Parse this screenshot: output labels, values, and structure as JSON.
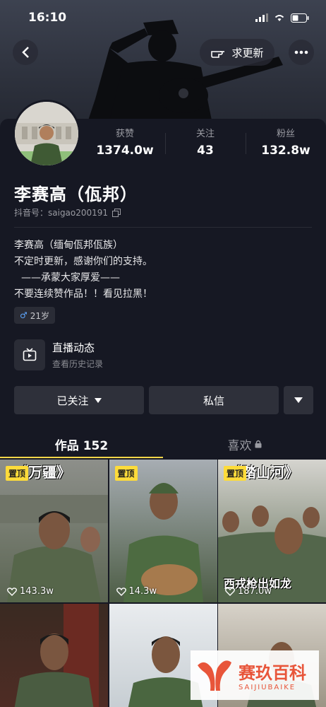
{
  "status": {
    "time": "16:10"
  },
  "header": {
    "update_label": "求更新"
  },
  "profile": {
    "name": "李赛高（佤邦）",
    "douyin_id": "抖音号：saigao200191",
    "bio_lines": [
      "李赛高（缅甸佤邦佤族）",
      "不定时更新，感谢你们的支持。",
      "——承蒙大家厚爱——",
      "不要连续赞作品！！看见拉黑！"
    ],
    "age": "21岁"
  },
  "stats": [
    {
      "label": "获赞",
      "value": "1374.0w"
    },
    {
      "label": "关注",
      "value": "43"
    },
    {
      "label": "粉丝",
      "value": "132.8w"
    }
  ],
  "live": {
    "title": "直播动态",
    "subtitle": "查看历史记录"
  },
  "actions": {
    "follow_label": "已关注",
    "message_label": "私信"
  },
  "tabs": [
    {
      "label": "作品 152"
    },
    {
      "label": "喜欢"
    }
  ],
  "videos": [
    {
      "pinned": "置顶",
      "overlay": "《万疆》",
      "likes": "143.3w"
    },
    {
      "pinned": "置顶",
      "overlay": "",
      "likes": "14.3w"
    },
    {
      "pinned": "置顶",
      "overlay": "《踏山河》",
      "caption": "西戎枪出如龙",
      "likes": "187.0w"
    },
    {
      "pinned": "",
      "overlay": "",
      "likes": ""
    },
    {
      "pinned": "",
      "overlay": "",
      "likes": ""
    },
    {
      "pinned": "",
      "overlay": "",
      "likes": ""
    }
  ],
  "watermark": {
    "title": "赛玖百科",
    "subtitle": "SAIJIUBAIKE"
  },
  "colors": {
    "accent": "#f7d64a",
    "pin_badge": "#fddb3a",
    "background": "#161823"
  }
}
